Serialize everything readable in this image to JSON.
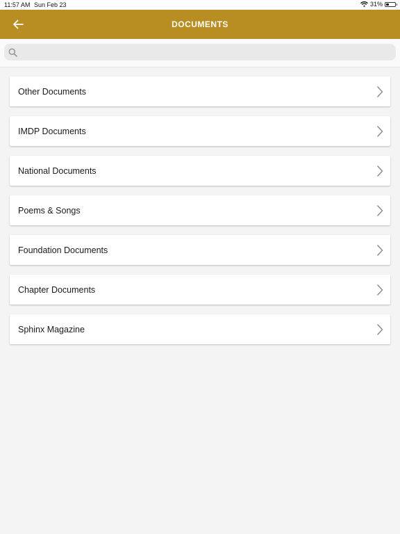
{
  "status_bar": {
    "time": "11:57 AM",
    "date": "Sun Feb 23",
    "battery": "31%",
    "battery_level": 0.31
  },
  "header": {
    "title": "DOCUMENTS",
    "back_icon": "arrow-left-icon",
    "background_color": "#b88d22"
  },
  "search": {
    "placeholder": "",
    "value": "",
    "icon": "search-icon"
  },
  "documents": {
    "items": [
      {
        "label": "Other Documents"
      },
      {
        "label": "IMDP Documents"
      },
      {
        "label": "National Documents"
      },
      {
        "label": "Poems & Songs"
      },
      {
        "label": "Foundation Documents"
      },
      {
        "label": "Chapter Documents"
      },
      {
        "label": "Sphinx Magazine"
      }
    ],
    "chevron_icon": "chevron-right-icon"
  }
}
